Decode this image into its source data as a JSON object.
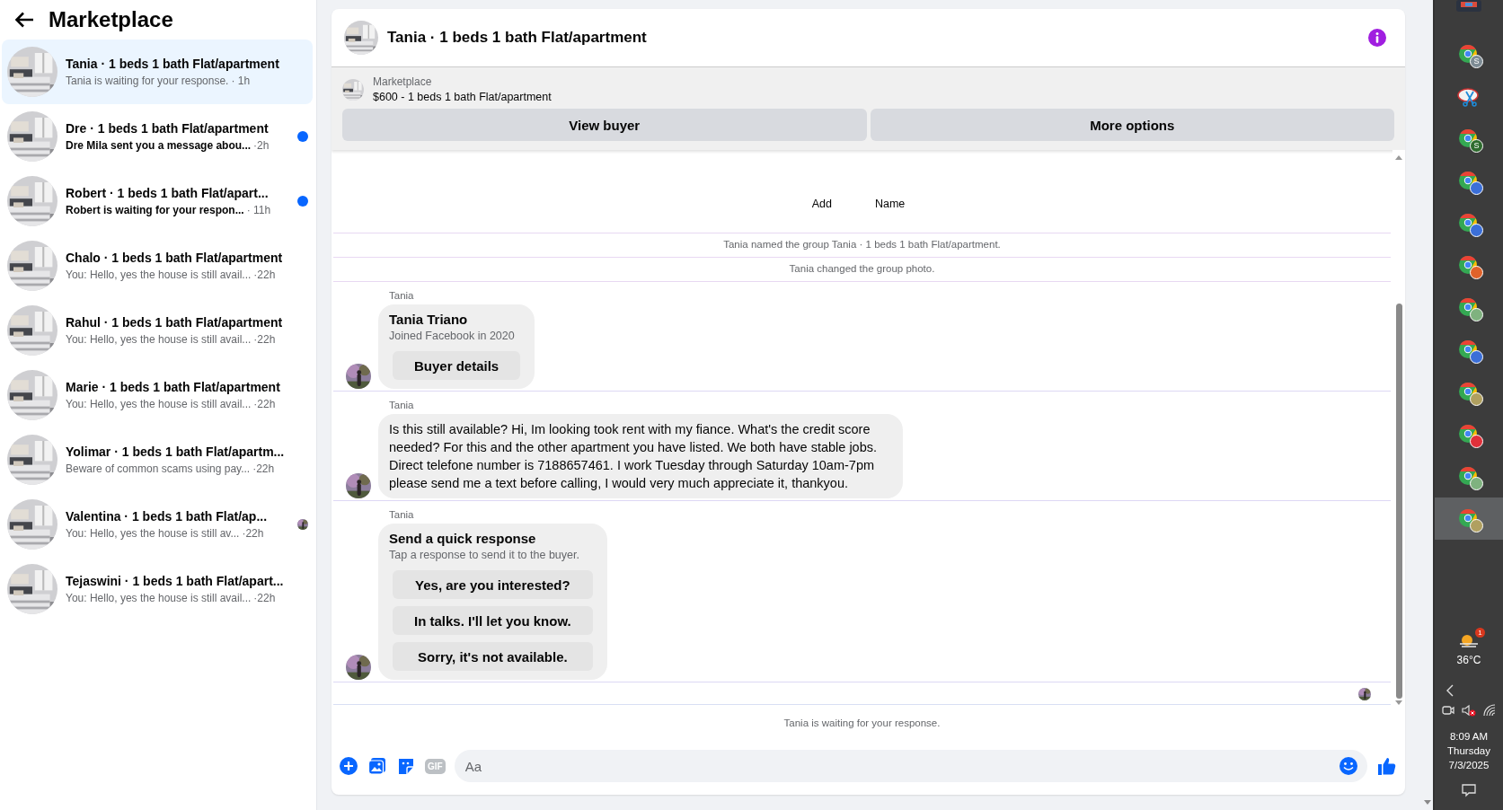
{
  "sidebar": {
    "title": "Marketplace",
    "conversations": [
      {
        "title": "Tania · 1 beds 1 bath Flat/apartment",
        "preview": "Tania is waiting for your response.",
        "time": "· 1h",
        "selected": true,
        "unread": false,
        "seen": false
      },
      {
        "title": "Dre · 1 beds 1 bath Flat/apartment",
        "preview": "Dre Mila sent you a message abou...",
        "time": "·2h",
        "selected": false,
        "unread": true,
        "seen": false
      },
      {
        "title": "Robert · 1 beds 1 bath Flat/apart...",
        "preview": "Robert is waiting for your respon...",
        "time": "· 11h",
        "selected": false,
        "unread": true,
        "seen": false
      },
      {
        "title": "Chalo · 1 beds 1 bath Flat/apartment",
        "preview": "You: Hello, yes the house is still avail...",
        "time": "·22h",
        "selected": false,
        "unread": false,
        "seen": false
      },
      {
        "title": "Rahul · 1 beds 1 bath Flat/apartment",
        "preview": "You: Hello, yes the house is still avail...",
        "time": "·22h",
        "selected": false,
        "unread": false,
        "seen": false
      },
      {
        "title": "Marie · 1 beds 1 bath Flat/apartment",
        "preview": "You: Hello, yes the house is still avail...",
        "time": "·22h",
        "selected": false,
        "unread": false,
        "seen": false
      },
      {
        "title": "Yolimar · 1 beds 1 bath Flat/apartm...",
        "preview": "Beware of common scams using pay...",
        "time": "·22h",
        "selected": false,
        "unread": false,
        "seen": false
      },
      {
        "title": "Valentina · 1 beds 1 bath Flat/ap...",
        "preview": "You: Hello, yes the house is still av...",
        "time": "·22h",
        "selected": false,
        "unread": false,
        "seen": true
      },
      {
        "title": "Tejaswini · 1 beds 1 bath Flat/apart...",
        "preview": "You: Hello, yes the house is still avail...",
        "time": "·22h",
        "selected": false,
        "unread": false,
        "seen": false
      }
    ]
  },
  "chat": {
    "title": "Tania · 1 beds 1 bath Flat/apartment",
    "listing": {
      "source": "Marketplace",
      "description": "$600 - 1 beds 1 bath Flat/apartment",
      "buttons": [
        "View buyer",
        "More options"
      ]
    },
    "cut_labels": [
      "Add",
      "Name"
    ],
    "events": [
      "Tania named the group Tania · 1 beds 1 bath Flat/apartment.",
      "Tania changed the group photo."
    ],
    "messages": [
      {
        "kind": "profile",
        "sender": "Tania",
        "name": "Tania Triano",
        "subtitle": "Joined Facebook in 2020",
        "button": "Buyer details"
      },
      {
        "kind": "text",
        "sender": "Tania",
        "text": "Is this still available? Hi, Im looking took rent with my fiance. What's the credit score needed? For this and the other apartment you have listed. We both have stable jobs. Direct telefone number is 7188657461. I work Tuesday through Saturday 10am-7pm please send me a text before calling, I would very much appreciate it, thankyou."
      },
      {
        "kind": "quick_replies",
        "sender": "Tania",
        "title": "Send a quick response",
        "subtitle": "Tap a response to send it to the buyer.",
        "options": [
          "Yes, are you interested?",
          "In talks. I'll let you know.",
          "Sorry, it's not available."
        ]
      }
    ],
    "status": "Tania is waiting for your response.",
    "composer": {
      "gif_label": "GIF",
      "placeholder": "Aa"
    }
  },
  "taskbar": {
    "apps": [
      {
        "kind": "chrome",
        "badge": "S",
        "color": "#7d8b94",
        "selected": false
      },
      {
        "kind": "snip",
        "selected": false
      },
      {
        "kind": "chrome",
        "badge": "S",
        "color": "#2e6b2e",
        "selected": false
      },
      {
        "kind": "chrome",
        "color": "#3b6fd8",
        "selected": false
      },
      {
        "kind": "chrome",
        "color": "#3b6fd8",
        "selected": false
      },
      {
        "kind": "chrome",
        "color": "#e0622a",
        "selected": false
      },
      {
        "kind": "chrome",
        "color": "#7fb27f",
        "selected": false
      },
      {
        "kind": "chrome",
        "color": "#3b6fd8",
        "selected": false
      },
      {
        "kind": "chrome",
        "color": "#b0a060",
        "selected": false
      },
      {
        "kind": "chrome",
        "color": "#e0303a",
        "selected": false
      },
      {
        "kind": "chrome",
        "color": "#7fb27f",
        "selected": false
      },
      {
        "kind": "chrome",
        "color": "#b0a060",
        "selected": true
      }
    ],
    "weather": {
      "badge": "1",
      "temperature": "36°C"
    },
    "clock": {
      "time": "8:09 AM",
      "day": "Thursday",
      "date": "7/3/2025"
    }
  }
}
